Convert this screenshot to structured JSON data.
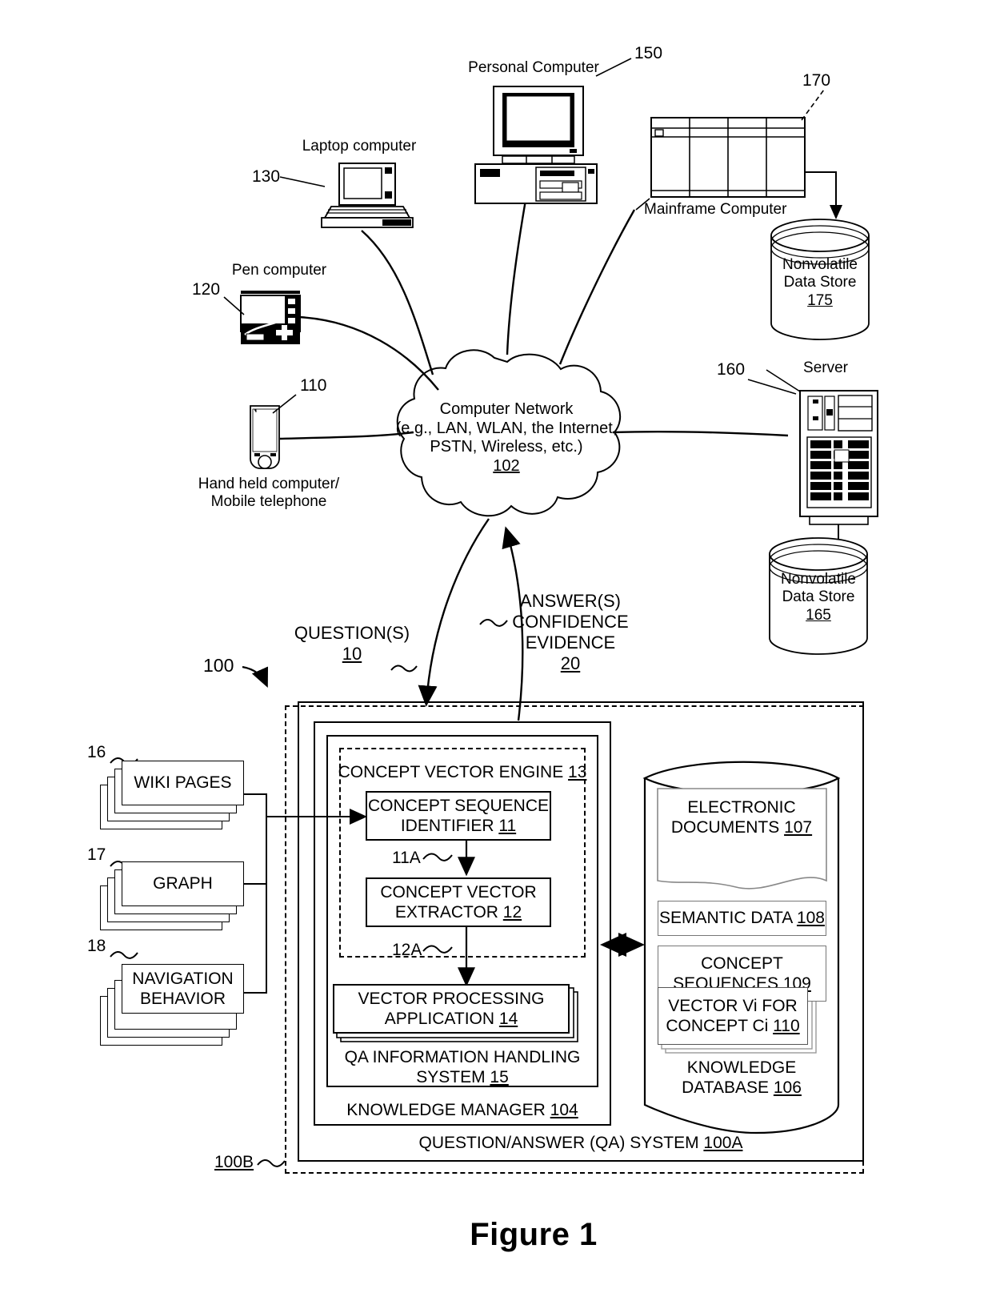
{
  "figure": {
    "caption": "Figure 1",
    "system_ref": "100",
    "lower_ref": "100B"
  },
  "network": {
    "title": "Computer Network",
    "line2": "(e.g., LAN, WLAN, the Internet,",
    "line3": "PSTN, Wireless, etc.)",
    "ref": "102"
  },
  "devices": [
    {
      "name": "personal-computer",
      "label": "Personal Computer",
      "ref": "150"
    },
    {
      "name": "laptop-computer",
      "label": "Laptop computer",
      "ref": "130"
    },
    {
      "name": "pen-computer",
      "label": "Pen computer",
      "ref": "120"
    },
    {
      "name": "handheld-computer",
      "label_line1": "Hand held computer/",
      "label_line2": "Mobile telephone",
      "ref": "110"
    },
    {
      "name": "mainframe-computer",
      "label": "Mainframe Computer",
      "ref": "170"
    },
    {
      "name": "server",
      "label": "Server",
      "ref": "160"
    }
  ],
  "data_stores": [
    {
      "name": "mainframe-data-store",
      "line1": "Nonvolatile",
      "line2": "Data Store",
      "ref": "175"
    },
    {
      "name": "server-data-store",
      "line1": "Nonvolatile",
      "line2": "Data Store",
      "ref": "165"
    }
  ],
  "flows": {
    "question": {
      "line1": "QUESTION(S)",
      "ref": "10"
    },
    "answer": {
      "line1": "ANSWER(S)",
      "line2": "CONFIDENCE",
      "line3": "EVIDENCE",
      "ref": "20"
    }
  },
  "sources": [
    {
      "name": "wiki-pages",
      "label": "WIKI PAGES",
      "ref": "16"
    },
    {
      "name": "graph",
      "label": "GRAPH",
      "ref": "17"
    },
    {
      "name": "navigation-behavior",
      "line1": "NAVIGATION",
      "line2": "BEHAVIOR",
      "ref": "18"
    }
  ],
  "qa_system": {
    "label": "QUESTION/ANSWER (QA) SYSTEM",
    "ref": "100A",
    "knowledge_manager": {
      "label": "KNOWLEDGE MANAGER",
      "ref": "104"
    },
    "qa_ihs": {
      "line1": "QA INFORMATION HANDLING",
      "line2": "SYSTEM",
      "ref": "15"
    },
    "concept_vector_engine": {
      "label": "CONCEPT VECTOR ENGINE",
      "ref": "13"
    },
    "concept_sequence_identifier": {
      "line1": "CONCEPT SEQUENCE",
      "line2": "IDENTIFIER",
      "ref": "11"
    },
    "concept_vector_extractor": {
      "line1": "CONCEPT VECTOR",
      "line2": "EXTRACTOR",
      "ref": "12"
    },
    "vector_processing_application": {
      "line1": "VECTOR PROCESSING",
      "line2": "APPLICATION",
      "ref": "14"
    },
    "link_11a": "11A",
    "link_12a": "12A"
  },
  "knowledge_database": {
    "line1": "KNOWLEDGE",
    "line2": "DATABASE",
    "ref": "106",
    "items": [
      {
        "name": "electronic-documents",
        "line1": "ELECTRONIC",
        "line2": "DOCUMENTS",
        "ref": "107"
      },
      {
        "name": "semantic-data",
        "label": "SEMANTIC DATA",
        "ref": "108"
      },
      {
        "name": "concept-sequences",
        "line1": "CONCEPT",
        "line2": "SEQUENCES",
        "ref": "109"
      },
      {
        "name": "vector-for-concept",
        "line1": "VECTOR Vi FOR",
        "line2": "CONCEPT Ci",
        "ref": "110"
      }
    ]
  },
  "colors": {
    "ink": "#000000",
    "paper": "#ffffff",
    "db_edge": "#777777"
  }
}
